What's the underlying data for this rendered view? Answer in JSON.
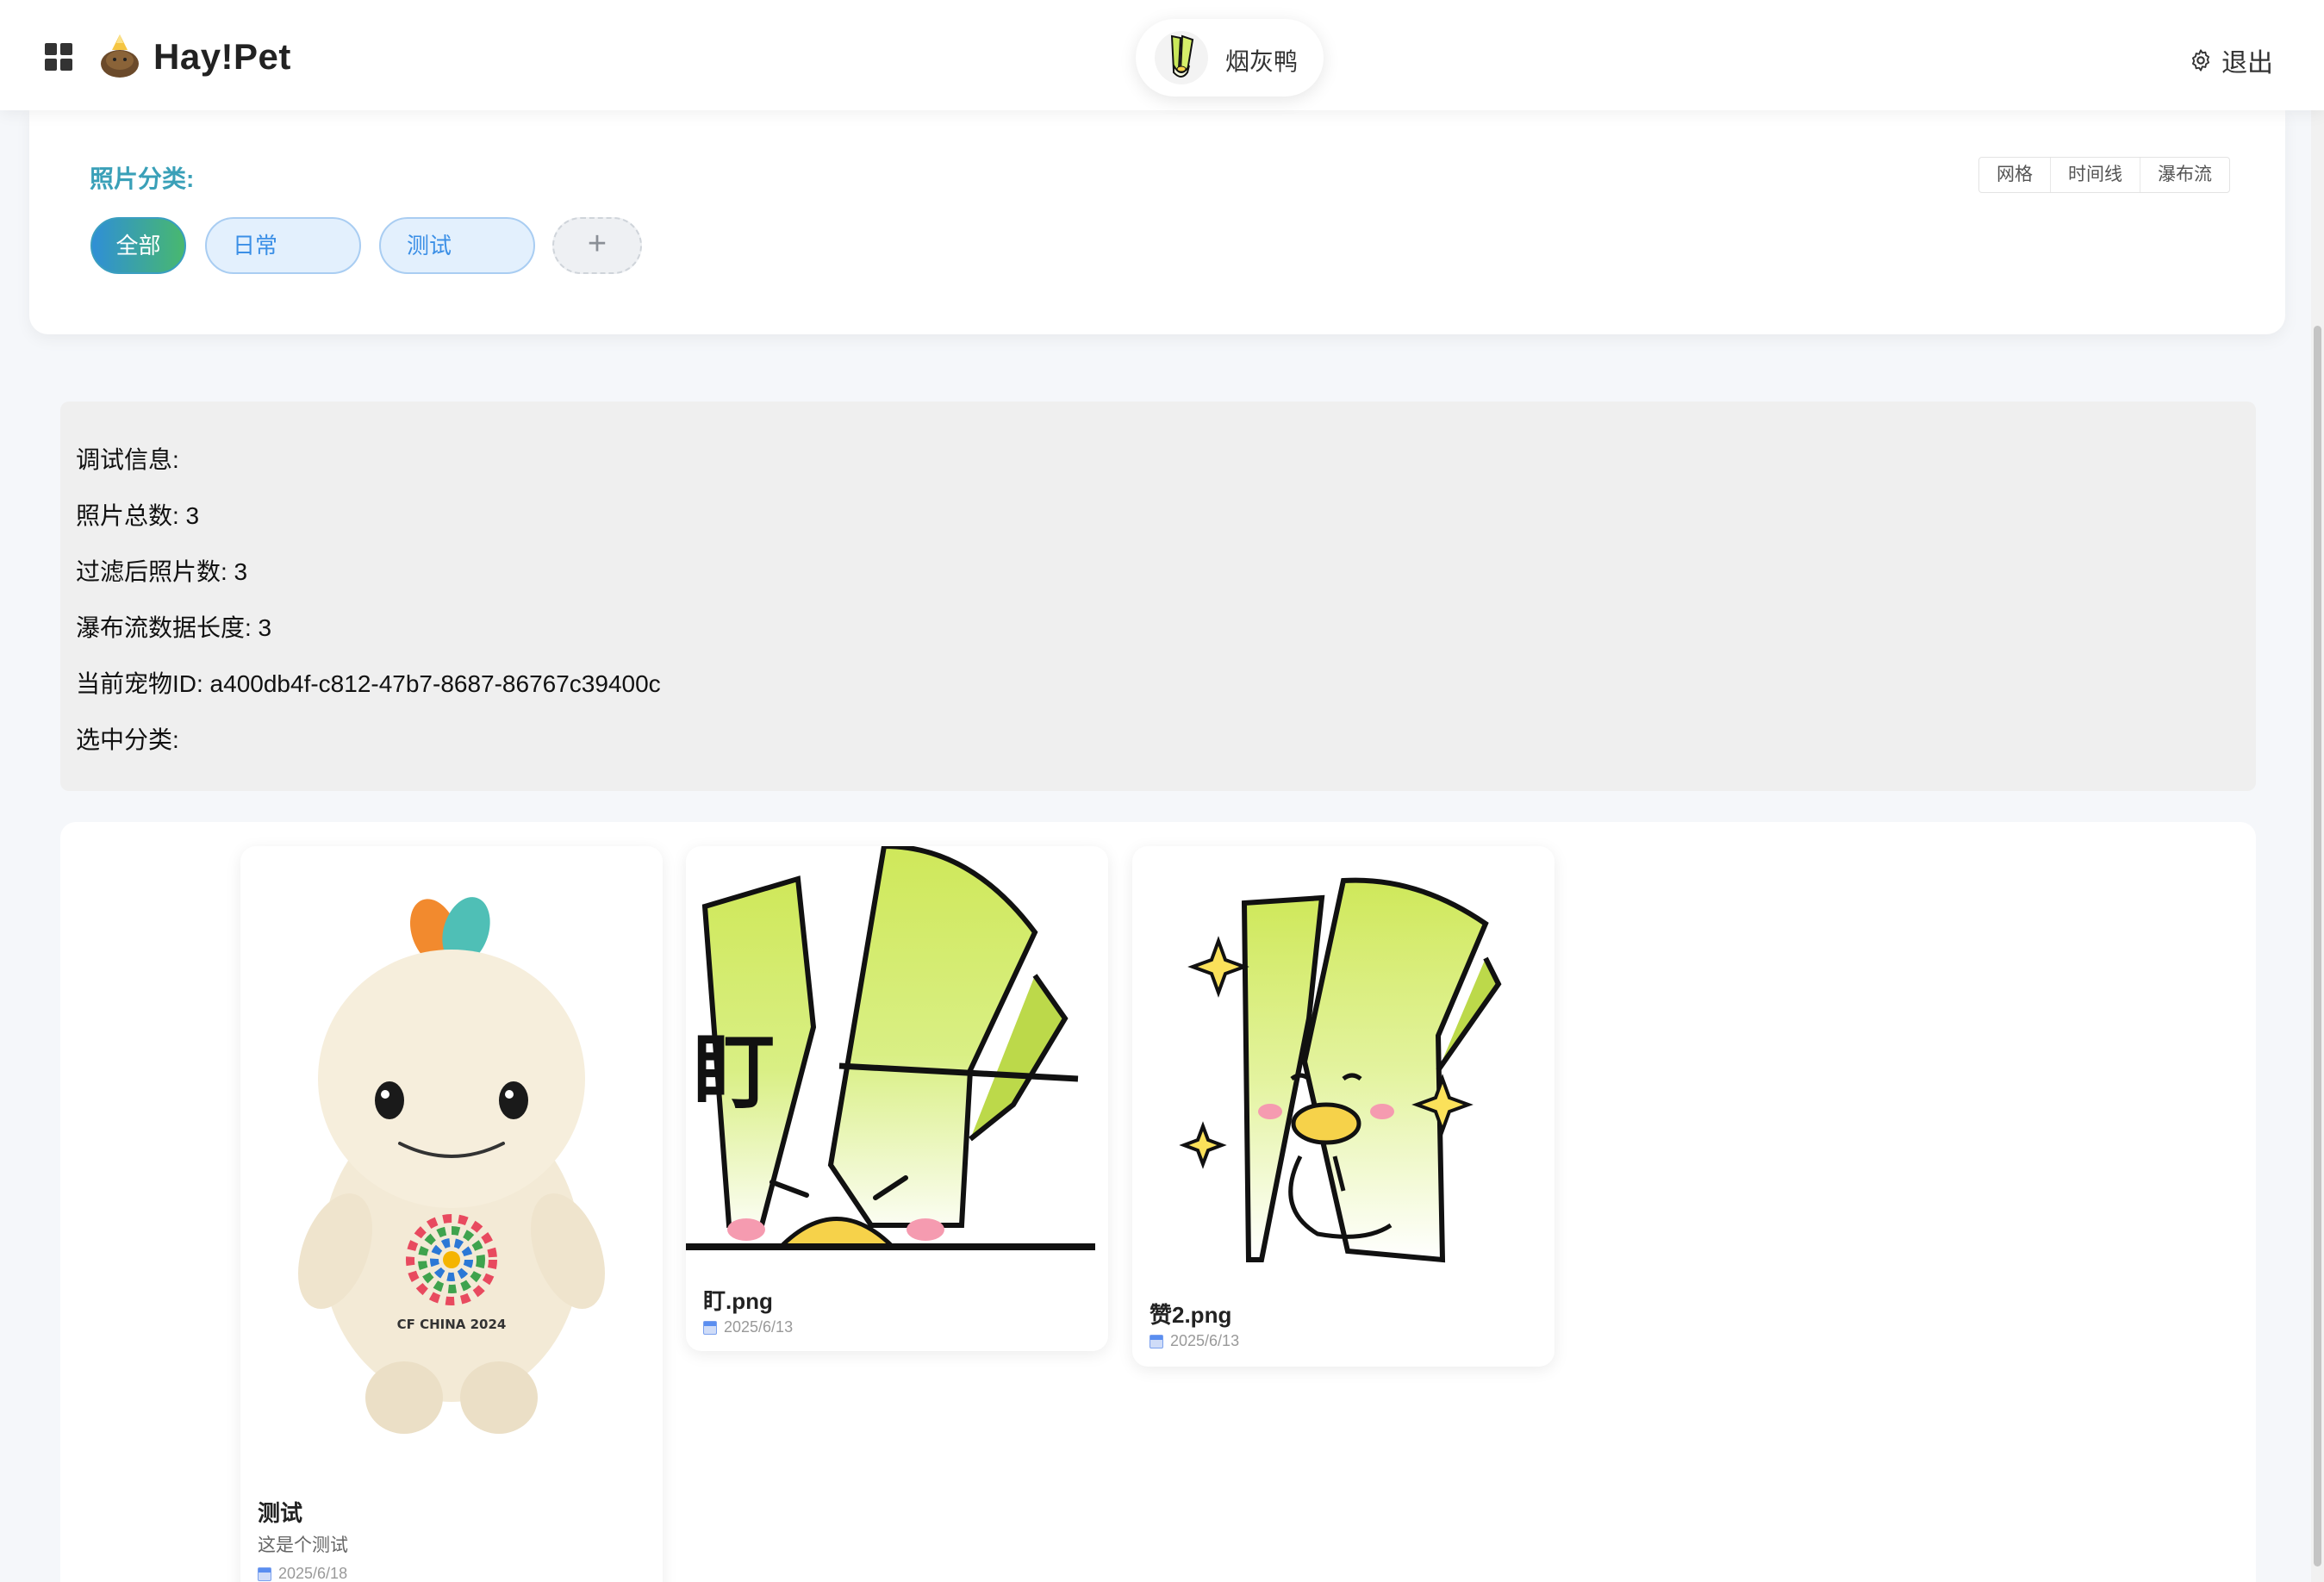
{
  "header": {
    "brand": "Hay!Pet",
    "pet_name": "烟灰鸭",
    "logout_label": "退出"
  },
  "categories": {
    "title": "照片分类:",
    "chips": [
      "全部",
      "日常",
      "测试"
    ],
    "add_label": "+",
    "view_modes": [
      "网格",
      "时间线",
      "瀑布流"
    ]
  },
  "debug": {
    "lines": [
      "调试信息:",
      "照片总数: 3",
      "过滤后照片数: 3",
      "瀑布流数据长度: 3",
      "当前宠物ID: a400db4f-c812-47b7-8687-86767c39400c",
      "选中分类:"
    ]
  },
  "photos": [
    {
      "title": "测试",
      "desc": "这是个测试",
      "date": "2025/6/18"
    },
    {
      "title": "盯.png",
      "date": "2025/6/13"
    },
    {
      "title": "赞2.png",
      "date": "2025/6/13"
    }
  ],
  "plush_print": "CF CHINA 2024",
  "sticker_text": "盯",
  "colors": {
    "accent": "#3aa0b8",
    "chip_active_start": "#2f8fd6",
    "chip_active_end": "#48b86f",
    "chip_bg": "#e3f0fd"
  }
}
